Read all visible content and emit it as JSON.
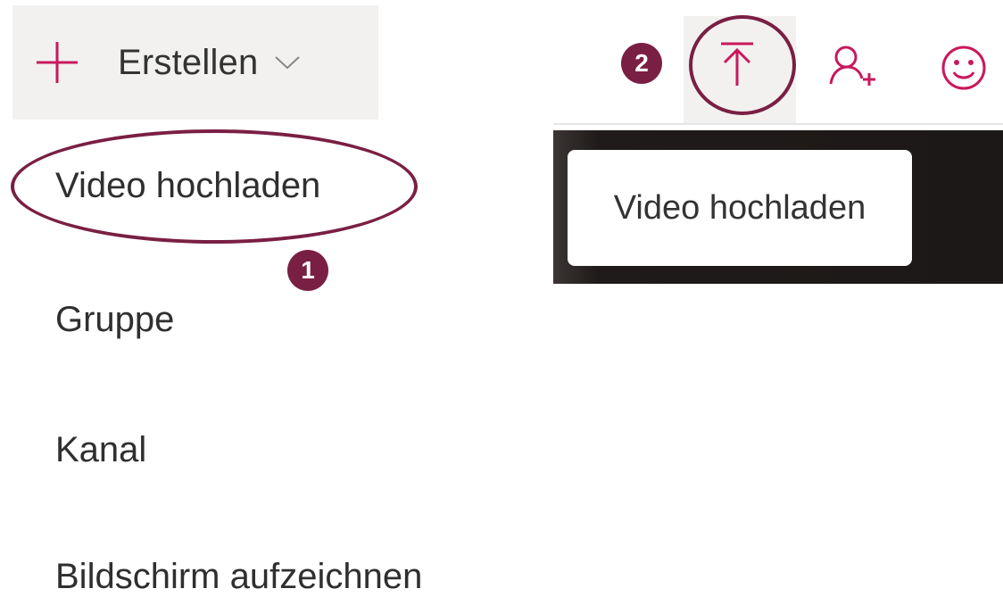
{
  "create_menu": {
    "button_label": "Erstellen",
    "items": [
      {
        "label": "Video hochladen"
      },
      {
        "label": "Gruppe"
      },
      {
        "label": "Kanal"
      },
      {
        "label": "Bildschirm aufzeichnen"
      }
    ]
  },
  "callouts": {
    "step1": "1",
    "step2": "2"
  },
  "toolbar": {
    "icons": [
      "upload-icon",
      "add-person-icon",
      "smiley-icon"
    ]
  },
  "tooltip": {
    "text": "Video hochladen"
  },
  "colors": {
    "accent": "#c8195d",
    "callout": "#7a1f44",
    "button_bg": "#f2f1f0",
    "tooltip_backdrop": "#1c1817"
  }
}
